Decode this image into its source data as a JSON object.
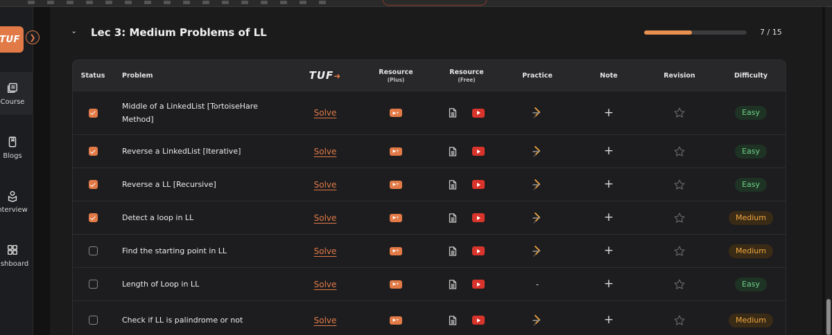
{
  "sidebar": {
    "logo_text": "TUF",
    "items": [
      {
        "label": "Course",
        "icon": "course-icon"
      },
      {
        "label": "Blogs",
        "icon": "book-icon"
      },
      {
        "label": "nterview",
        "icon": "interview-icon"
      },
      {
        "label": "ashboard",
        "icon": "dashboard-icon"
      }
    ]
  },
  "section": {
    "title": "Lec 3: Medium Problems of LL",
    "progress_text": "7 / 15",
    "progress_fraction": 0.467
  },
  "table": {
    "headers": {
      "status": "Status",
      "problem": "Problem",
      "tuf": "TUF",
      "resource_plus": "Resource",
      "resource_plus_sub": "(Plus)",
      "resource_free": "Resource",
      "resource_free_sub": "(Free)",
      "practice": "Practice",
      "note": "Note",
      "revision": "Revision",
      "difficulty": "Difficulty"
    },
    "solve_label": "Solve",
    "rows": [
      {
        "checked": true,
        "problem": "Middle of a LinkedList [TortoiseHare Method]",
        "practice": "icon",
        "difficulty": "Easy"
      },
      {
        "checked": true,
        "problem": "Reverse a LinkedList [Iterative]",
        "practice": "icon",
        "difficulty": "Easy"
      },
      {
        "checked": true,
        "problem": "Reverse a LL [Recursive]",
        "practice": "icon",
        "difficulty": "Easy"
      },
      {
        "checked": true,
        "problem": "Detect a loop in LL",
        "practice": "icon",
        "difficulty": "Medium"
      },
      {
        "checked": false,
        "problem": "Find the starting point in LL",
        "practice": "icon",
        "difficulty": "Medium"
      },
      {
        "checked": false,
        "problem": "Length of Loop in LL",
        "practice": "-",
        "difficulty": "Easy"
      },
      {
        "checked": false,
        "problem": "Check if LL is palindrome or not",
        "practice": "icon",
        "difficulty": "Medium"
      }
    ]
  },
  "colors": {
    "accent": "#e27a47",
    "easy": "#6fd28a",
    "medium": "#f2a942",
    "youtube": "#d9342b"
  }
}
